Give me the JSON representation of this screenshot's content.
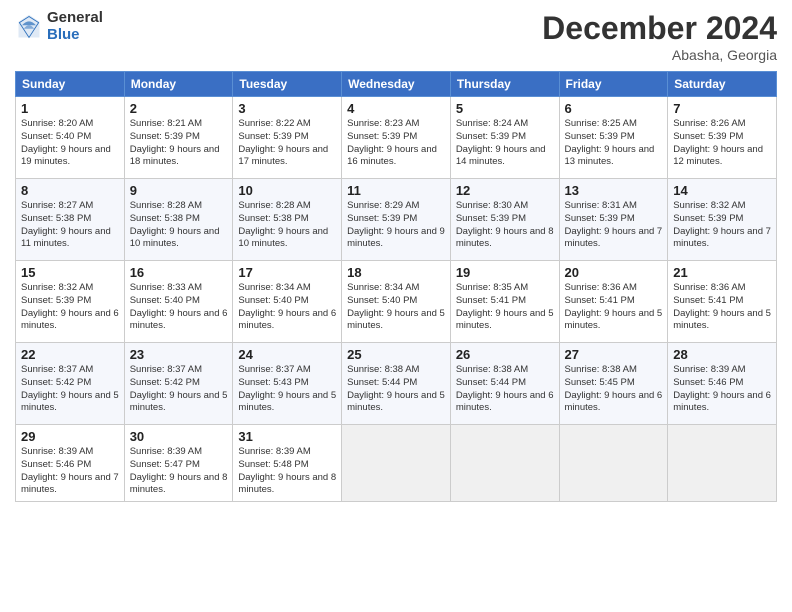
{
  "header": {
    "logo_general": "General",
    "logo_blue": "Blue",
    "month_title": "December 2024",
    "subtitle": "Abasha, Georgia"
  },
  "weekdays": [
    "Sunday",
    "Monday",
    "Tuesday",
    "Wednesday",
    "Thursday",
    "Friday",
    "Saturday"
  ],
  "rows": [
    [
      {
        "day": "1",
        "sunrise": "8:20 AM",
        "sunset": "5:40 PM",
        "daylight": "9 hours and 19 minutes"
      },
      {
        "day": "2",
        "sunrise": "8:21 AM",
        "sunset": "5:39 PM",
        "daylight": "9 hours and 18 minutes"
      },
      {
        "day": "3",
        "sunrise": "8:22 AM",
        "sunset": "5:39 PM",
        "daylight": "9 hours and 17 minutes"
      },
      {
        "day": "4",
        "sunrise": "8:23 AM",
        "sunset": "5:39 PM",
        "daylight": "9 hours and 16 minutes"
      },
      {
        "day": "5",
        "sunrise": "8:24 AM",
        "sunset": "5:39 PM",
        "daylight": "9 hours and 14 minutes"
      },
      {
        "day": "6",
        "sunrise": "8:25 AM",
        "sunset": "5:39 PM",
        "daylight": "9 hours and 13 minutes"
      },
      {
        "day": "7",
        "sunrise": "8:26 AM",
        "sunset": "5:39 PM",
        "daylight": "9 hours and 12 minutes"
      }
    ],
    [
      {
        "day": "8",
        "sunrise": "8:27 AM",
        "sunset": "5:38 PM",
        "daylight": "9 hours and 11 minutes"
      },
      {
        "day": "9",
        "sunrise": "8:28 AM",
        "sunset": "5:38 PM",
        "daylight": "9 hours and 10 minutes"
      },
      {
        "day": "10",
        "sunrise": "8:28 AM",
        "sunset": "5:38 PM",
        "daylight": "9 hours and 10 minutes"
      },
      {
        "day": "11",
        "sunrise": "8:29 AM",
        "sunset": "5:39 PM",
        "daylight": "9 hours and 9 minutes"
      },
      {
        "day": "12",
        "sunrise": "8:30 AM",
        "sunset": "5:39 PM",
        "daylight": "9 hours and 8 minutes"
      },
      {
        "day": "13",
        "sunrise": "8:31 AM",
        "sunset": "5:39 PM",
        "daylight": "9 hours and 7 minutes"
      },
      {
        "day": "14",
        "sunrise": "8:32 AM",
        "sunset": "5:39 PM",
        "daylight": "9 hours and 7 minutes"
      }
    ],
    [
      {
        "day": "15",
        "sunrise": "8:32 AM",
        "sunset": "5:39 PM",
        "daylight": "9 hours and 6 minutes"
      },
      {
        "day": "16",
        "sunrise": "8:33 AM",
        "sunset": "5:40 PM",
        "daylight": "9 hours and 6 minutes"
      },
      {
        "day": "17",
        "sunrise": "8:34 AM",
        "sunset": "5:40 PM",
        "daylight": "9 hours and 6 minutes"
      },
      {
        "day": "18",
        "sunrise": "8:34 AM",
        "sunset": "5:40 PM",
        "daylight": "9 hours and 5 minutes"
      },
      {
        "day": "19",
        "sunrise": "8:35 AM",
        "sunset": "5:41 PM",
        "daylight": "9 hours and 5 minutes"
      },
      {
        "day": "20",
        "sunrise": "8:36 AM",
        "sunset": "5:41 PM",
        "daylight": "9 hours and 5 minutes"
      },
      {
        "day": "21",
        "sunrise": "8:36 AM",
        "sunset": "5:41 PM",
        "daylight": "9 hours and 5 minutes"
      }
    ],
    [
      {
        "day": "22",
        "sunrise": "8:37 AM",
        "sunset": "5:42 PM",
        "daylight": "9 hours and 5 minutes"
      },
      {
        "day": "23",
        "sunrise": "8:37 AM",
        "sunset": "5:42 PM",
        "daylight": "9 hours and 5 minutes"
      },
      {
        "day": "24",
        "sunrise": "8:37 AM",
        "sunset": "5:43 PM",
        "daylight": "9 hours and 5 minutes"
      },
      {
        "day": "25",
        "sunrise": "8:38 AM",
        "sunset": "5:44 PM",
        "daylight": "9 hours and 5 minutes"
      },
      {
        "day": "26",
        "sunrise": "8:38 AM",
        "sunset": "5:44 PM",
        "daylight": "9 hours and 6 minutes"
      },
      {
        "day": "27",
        "sunrise": "8:38 AM",
        "sunset": "5:45 PM",
        "daylight": "9 hours and 6 minutes"
      },
      {
        "day": "28",
        "sunrise": "8:39 AM",
        "sunset": "5:46 PM",
        "daylight": "9 hours and 6 minutes"
      }
    ],
    [
      {
        "day": "29",
        "sunrise": "8:39 AM",
        "sunset": "5:46 PM",
        "daylight": "9 hours and 7 minutes"
      },
      {
        "day": "30",
        "sunrise": "8:39 AM",
        "sunset": "5:47 PM",
        "daylight": "9 hours and 8 minutes"
      },
      {
        "day": "31",
        "sunrise": "8:39 AM",
        "sunset": "5:48 PM",
        "daylight": "9 hours and 8 minutes"
      },
      null,
      null,
      null,
      null
    ]
  ],
  "labels": {
    "sunrise": "Sunrise:",
    "sunset": "Sunset:",
    "daylight": "Daylight:"
  }
}
